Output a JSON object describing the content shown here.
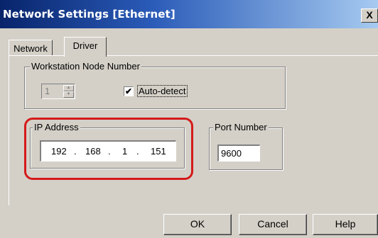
{
  "window": {
    "title": "Network Settings [Ethernet]",
    "close_label": "X"
  },
  "tabs": [
    {
      "label": "Network",
      "active": false
    },
    {
      "label": "Driver",
      "active": true
    }
  ],
  "workstation": {
    "group_label": "Workstation Node Number",
    "node_value": "1",
    "auto_detect_label": "Auto-detect",
    "auto_detect_checked": true,
    "check_glyph": "✔"
  },
  "ip_address": {
    "group_label": "IP Address",
    "octets": [
      "192",
      "168",
      "1",
      "151"
    ]
  },
  "port": {
    "group_label": "Port Number",
    "value": "9600"
  },
  "buttons": {
    "ok": "OK",
    "cancel": "Cancel",
    "help": "Help"
  },
  "colors": {
    "title_start": "#08246b",
    "title_end": "#a6caf0",
    "dialog_bg": "#d4d0c8",
    "highlight": "#d41a1a"
  }
}
